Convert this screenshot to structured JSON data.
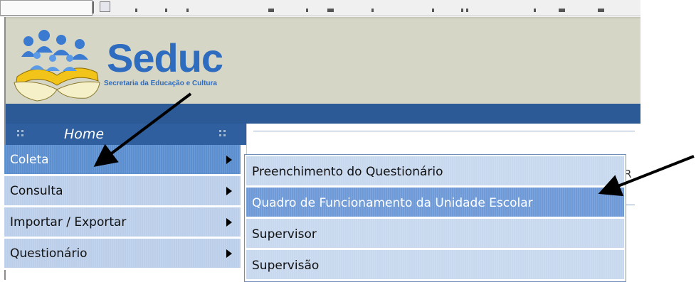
{
  "app": {
    "logo_title": "Seduc",
    "logo_subtitle": "Secretaria da Educação e Cultura",
    "home_label": "Home",
    "partial_text": "R"
  },
  "menu": {
    "items": [
      {
        "label": "Coleta",
        "active": true,
        "has_submenu": true
      },
      {
        "label": "Consulta",
        "active": false,
        "has_submenu": true
      },
      {
        "label": "Importar / Exportar",
        "active": false,
        "has_submenu": true
      },
      {
        "label": "Questionário",
        "active": false,
        "has_submenu": true
      }
    ]
  },
  "submenu": {
    "items": [
      {
        "label": "Preenchimento do Questionário",
        "active": false
      },
      {
        "label": "Quadro de Funcionamento da Unidade Escolar",
        "active": true
      },
      {
        "label": "Supervisor",
        "active": false
      },
      {
        "label": "Supervisão",
        "active": false
      }
    ]
  },
  "colors": {
    "header_bg": "#d6d6c6",
    "nav_blue": "#2c5a96",
    "menu_item": "#bccfea",
    "menu_active": "#5c8fd0",
    "logo_blue": "#2e6cc0",
    "book_yellow": "#f2c318"
  },
  "icons": [
    "people-logo-icon",
    "book-logo-icon",
    "submenu-arrow-icon",
    "home-grip-icon"
  ]
}
